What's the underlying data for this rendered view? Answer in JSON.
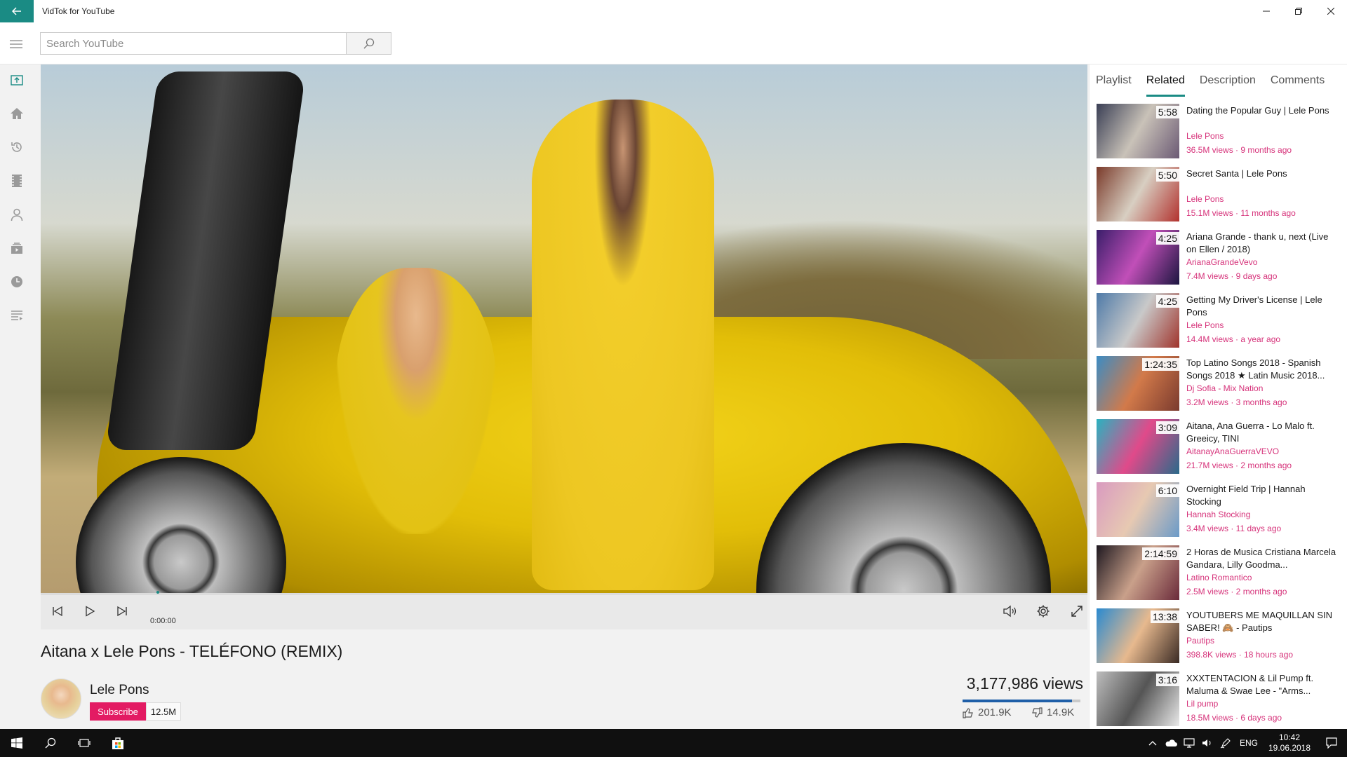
{
  "window": {
    "title": "VidTok for YouTube"
  },
  "search": {
    "placeholder": "Search YouTube",
    "value": ""
  },
  "nav_icons": [
    "upload-icon",
    "home-icon",
    "history-icon",
    "film-icon",
    "person-icon",
    "subscriptions-icon",
    "clock-icon",
    "playlist-icon"
  ],
  "player": {
    "time": "0:00:00",
    "progress_fraction": 0.0
  },
  "video": {
    "title": "Aitana x Lele Pons - TELÉFONO (REMIX)",
    "channel": "Lele Pons",
    "subscribe_label": "Subscribe",
    "subscribers": "12.5M",
    "views": "3,177,986  views",
    "likes": "201.9K",
    "dislikes": "14.9K",
    "like_ratio": 0.93
  },
  "tabs": [
    {
      "label": "Playlist",
      "active": false
    },
    {
      "label": "Related",
      "active": true
    },
    {
      "label": "Description",
      "active": false
    },
    {
      "label": "Comments",
      "active": false
    }
  ],
  "related": [
    {
      "title": "Dating the Popular Guy | Lele Pons",
      "channel": "Lele Pons",
      "meta": "36.5M views · 9 months ago",
      "duration": "5:58",
      "thumb": [
        "#3a3f55",
        "#c9c2b8",
        "#6b5a74"
      ]
    },
    {
      "title": "Secret Santa | Lele Pons",
      "channel": "Lele Pons",
      "meta": "15.1M views · 11 months ago",
      "duration": "5:50",
      "thumb": [
        "#7a3a2a",
        "#d8cfc2",
        "#b2322e"
      ]
    },
    {
      "title": "Ariana Grande - thank u, next (Live on Ellen / 2018)",
      "channel": "ArianaGrandeVevo",
      "meta": "7.4M views · 9 days ago",
      "duration": "4:25",
      "thumb": [
        "#3a1e6a",
        "#c14fb8",
        "#1c1640"
      ]
    },
    {
      "title": "Getting My Driver's License | Lele Pons",
      "channel": "Lele Pons",
      "meta": "14.4M views · a year ago",
      "duration": "4:25",
      "thumb": [
        "#4e7aa8",
        "#c9c9c9",
        "#a0342c"
      ]
    },
    {
      "title": "Top Latino Songs 2018 - Spanish Songs 2018 ★ Latin Music 2018...",
      "channel": "Dj Sofia - Mix Nation",
      "meta": "3.2M views · 3 months ago",
      "duration": "1:24:35",
      "thumb": [
        "#3b8cc4",
        "#d27a4a",
        "#7a3a2e"
      ]
    },
    {
      "title": "Aitana, Ana Guerra - Lo Malo ft. Greeicy, TINI",
      "channel": "AitanayAnaGuerraVEVO",
      "meta": "21.7M views · 2 months ago",
      "duration": "3:09",
      "thumb": [
        "#2ab2c0",
        "#e04a8a",
        "#2a6a8a"
      ]
    },
    {
      "title": "Overnight Field Trip | Hannah Stocking",
      "channel": "Hannah Stocking",
      "meta": "3.4M views · 11 days ago",
      "duration": "6:10",
      "thumb": [
        "#d99ac0",
        "#e7c9b2",
        "#6a9ac8"
      ]
    },
    {
      "title": "2 Horas de Musica Cristiana Marcela Gandara, Lilly Goodma...",
      "channel": "Latino Romantico",
      "meta": "2.5M views · 2 months ago",
      "duration": "2:14:59",
      "thumb": [
        "#1e1820",
        "#c9a08a",
        "#6a2a3a"
      ]
    },
    {
      "title": "YOUTUBERS ME MAQUILLAN SIN SABER! 🙈 - Pautips",
      "channel": "Pautips",
      "meta": "398.8K views · 18 hours ago",
      "duration": "13:38",
      "thumb": [
        "#2a8ad0",
        "#e7b98e",
        "#3a2a24"
      ]
    },
    {
      "title": "XXXTENTACION & Lil Pump ft. Maluma & Swae Lee  - \"Arms...",
      "channel": "Lil pump",
      "meta": "18.5M views · 6 days ago",
      "duration": "3:16",
      "thumb": [
        "#bdbdbd",
        "#555555",
        "#e9e9e9"
      ]
    }
  ],
  "taskbar": {
    "language": "ENG",
    "time": "10:42",
    "date": "19.06.2018"
  },
  "colors": {
    "accent": "#1a8b84",
    "subscribe": "#e31b63",
    "channel_link": "#d6327a",
    "like_bar": "#1f5fa8"
  }
}
